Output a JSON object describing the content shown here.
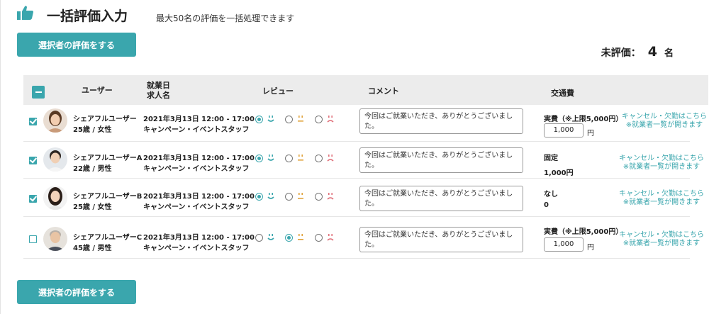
{
  "header": {
    "title": "一括評価入力",
    "subtitle": "最大50名の評価を一括処理できます",
    "icon": "thumbs-up-icon"
  },
  "actions": {
    "bulk_button_label": "選択者の評価をする"
  },
  "summary": {
    "label": "未評価：",
    "count": "4",
    "unit": "名"
  },
  "table": {
    "columns": {
      "user": "ユーザー",
      "date": "就業日",
      "job": "求人名",
      "review": "レビュー",
      "comment": "コメント",
      "fare": "交通費"
    },
    "rows": [
      {
        "checked": true,
        "name": "シェアフルユーザー",
        "info": "25歳 / 女性",
        "date": "2021年3月13日 12:00 - 17:00",
        "job": "キャンペーン・イベントスタッフ",
        "review": "good",
        "comment": "今回はご就業いただき、ありがとうございました。",
        "fare_label": "実費（※上限5,000円）",
        "fare_value": "1,000",
        "fare_unit": "円",
        "cancel_link": "キャンセル・欠勤はこちら",
        "cancel_note": "※就業者一覧が開きます"
      },
      {
        "checked": true,
        "name": "シェアフルユーザーA",
        "info": "22歳 / 男性",
        "date": "2021年3月13日 12:00 - 17:00",
        "job": "キャンペーン・イベントスタッフ",
        "review": "good",
        "comment": "今回はご就業いただき、ありがとうございました。",
        "fare_label": "固定",
        "fare_value": "1,000円",
        "cancel_link": "キャンセル・欠勤はこちら",
        "cancel_note": "※就業者一覧が開きます"
      },
      {
        "checked": true,
        "name": "シェアフルユーザーB",
        "info": "25歳 / 女性",
        "date": "2021年3月13日 12:00 - 17:00",
        "job": "キャンペーン・イベントスタッフ",
        "review": "good",
        "comment": "今回はご就業いただき、ありがとうございました。",
        "fare_label": "なし",
        "fare_value": "0",
        "cancel_link": "キャンセル・欠勤はこちら",
        "cancel_note": "※就業者一覧が開きます"
      },
      {
        "checked": false,
        "name": "シェアフルユーザーC",
        "info": "45歳 / 男性",
        "date": "2021年3月13日 12:00 - 17:00",
        "job": "キャンペーン・イベントスタッフ",
        "review": "normal",
        "comment": "今回はご就業いただき、ありがとうございました。",
        "fare_label": "実費（※上限5,000円）",
        "fare_value": "1,000",
        "fare_unit": "円",
        "cancel_link": "キャンセル・欠勤はこちら",
        "cancel_note": "※就業者一覧が開きます"
      }
    ]
  },
  "colors": {
    "accent": "#3aa6ad",
    "good_face": "#3aa6ad",
    "normal_face": "#e0a23a",
    "bad_face": "#e0707a"
  }
}
